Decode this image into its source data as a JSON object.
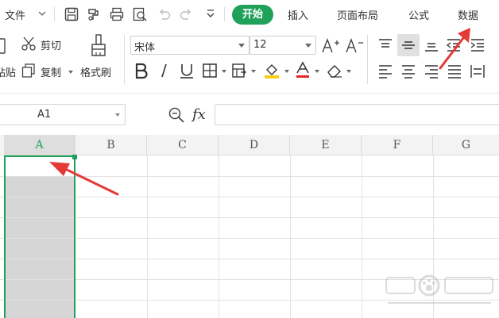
{
  "menubar": {
    "file_label": "文件",
    "tabs": [
      {
        "label": "开始",
        "active": true
      },
      {
        "label": "插入"
      },
      {
        "label": "页面布局"
      },
      {
        "label": "公式"
      },
      {
        "label": "数据"
      }
    ],
    "quick_access_icons": [
      "save-icon",
      "format-painter-icon",
      "print-icon",
      "print-preview-icon",
      "undo-icon",
      "redo-icon",
      "customize-icon"
    ]
  },
  "ribbon": {
    "paste_label": "粘贴",
    "cut_label": "剪切",
    "copy_label": "复制",
    "format_painter_label": "格式刷",
    "font_name": "宋体",
    "font_size": "12",
    "font_color": "#e32727",
    "highlight_color": "#f5d017",
    "accent": "#1fa15a"
  },
  "formula_bar": {
    "cell_ref": "A1",
    "fx_label": "fx",
    "formula_value": ""
  },
  "sheet": {
    "columns": [
      "A",
      "B",
      "C",
      "D",
      "E",
      "F",
      "G"
    ],
    "selected_column": "A"
  }
}
